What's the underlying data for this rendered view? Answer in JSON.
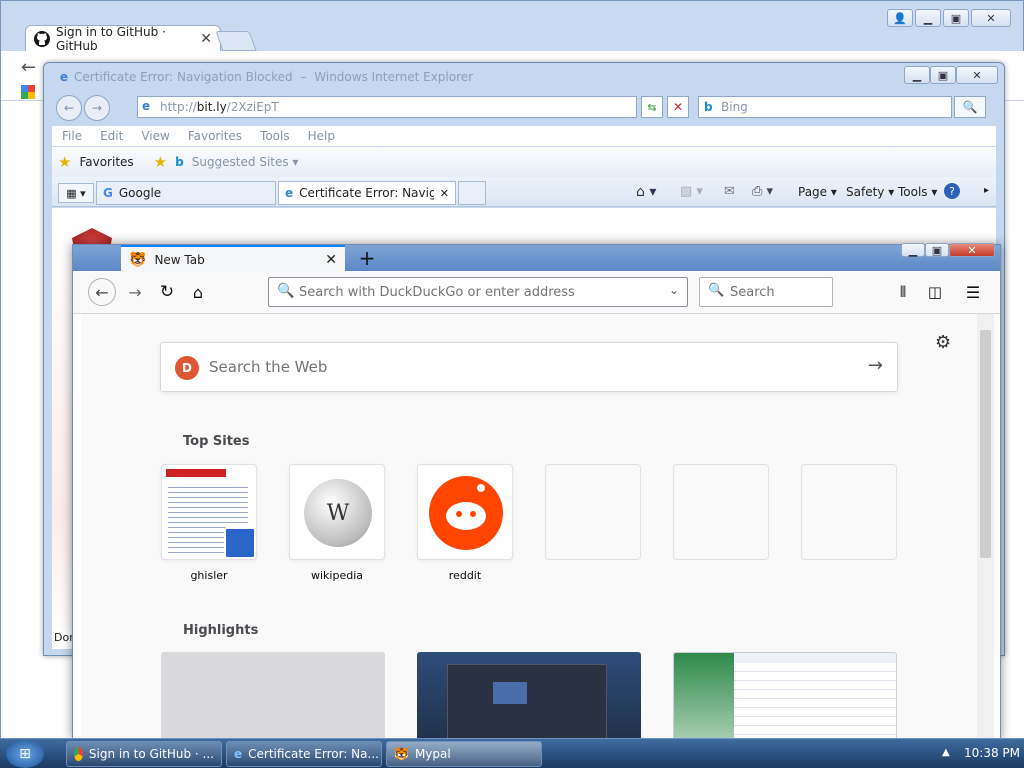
{
  "chrome": {
    "tab_title": "Sign in to GitHub · GitHub",
    "status_partial": "Dor"
  },
  "ie": {
    "title": "Certificate Error: Navigation Blocked",
    "title_app": "Windows Internet Explorer",
    "address_prefix": "http://",
    "address_main": "bit.ly",
    "address_suffix": "/2XziEpT",
    "search_placeholder": "Bing",
    "menu": [
      "File",
      "Edit",
      "View",
      "Favorites",
      "Tools",
      "Help"
    ],
    "favorites_label": "Favorites",
    "suggested_sites": "Suggested Sites ▾",
    "tabs": [
      {
        "label": "Google"
      },
      {
        "label": "Certificate Error: Navigat..."
      }
    ],
    "cmd": {
      "page": "Page ▾",
      "safety": "Safety ▾",
      "tools": "Tools ▾"
    }
  },
  "firefox": {
    "tab_title": "New Tab",
    "url_placeholder": "Search with DuckDuckGo or enter address",
    "search_placeholder": "Search",
    "web_search_placeholder": "Search the Web",
    "top_sites_heading": "Top Sites",
    "top_sites": [
      {
        "label": "ghisler"
      },
      {
        "label": "wikipedia"
      },
      {
        "label": "reddit"
      }
    ],
    "highlights_heading": "Highlights"
  },
  "taskbar": {
    "items": [
      {
        "label": "Sign in to GitHub · ..."
      },
      {
        "label": "Certificate Error: Na..."
      },
      {
        "label": "Mypal"
      }
    ],
    "clock": "10:38 PM"
  }
}
